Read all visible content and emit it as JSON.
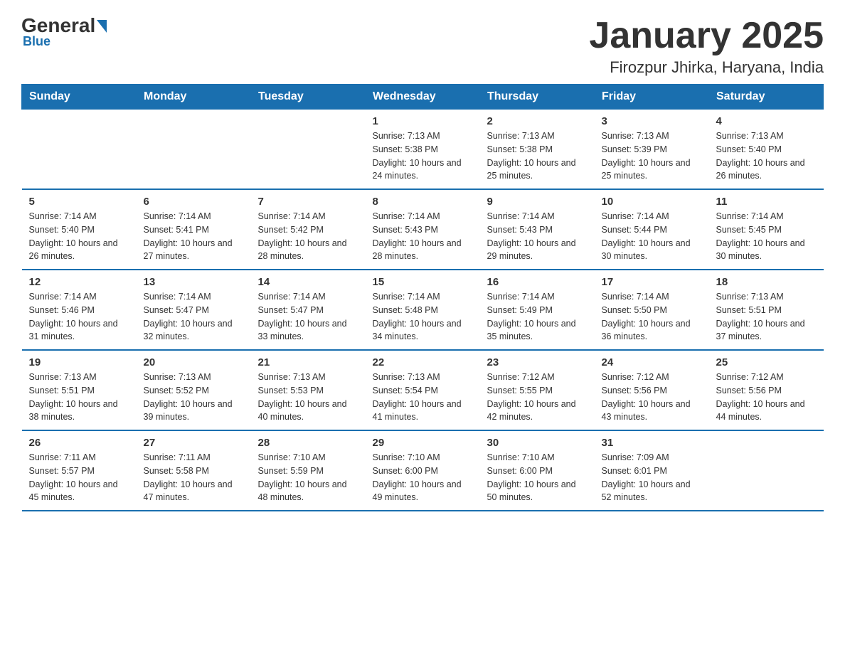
{
  "header": {
    "logo_general": "General",
    "logo_blue": "Blue",
    "title": "January 2025",
    "subtitle": "Firozpur Jhirka, Haryana, India"
  },
  "days_of_week": [
    "Sunday",
    "Monday",
    "Tuesday",
    "Wednesday",
    "Thursday",
    "Friday",
    "Saturday"
  ],
  "weeks": [
    [
      {
        "num": "",
        "sunrise": "",
        "sunset": "",
        "daylight": ""
      },
      {
        "num": "",
        "sunrise": "",
        "sunset": "",
        "daylight": ""
      },
      {
        "num": "",
        "sunrise": "",
        "sunset": "",
        "daylight": ""
      },
      {
        "num": "1",
        "sunrise": "Sunrise: 7:13 AM",
        "sunset": "Sunset: 5:38 PM",
        "daylight": "Daylight: 10 hours and 24 minutes."
      },
      {
        "num": "2",
        "sunrise": "Sunrise: 7:13 AM",
        "sunset": "Sunset: 5:38 PM",
        "daylight": "Daylight: 10 hours and 25 minutes."
      },
      {
        "num": "3",
        "sunrise": "Sunrise: 7:13 AM",
        "sunset": "Sunset: 5:39 PM",
        "daylight": "Daylight: 10 hours and 25 minutes."
      },
      {
        "num": "4",
        "sunrise": "Sunrise: 7:13 AM",
        "sunset": "Sunset: 5:40 PM",
        "daylight": "Daylight: 10 hours and 26 minutes."
      }
    ],
    [
      {
        "num": "5",
        "sunrise": "Sunrise: 7:14 AM",
        "sunset": "Sunset: 5:40 PM",
        "daylight": "Daylight: 10 hours and 26 minutes."
      },
      {
        "num": "6",
        "sunrise": "Sunrise: 7:14 AM",
        "sunset": "Sunset: 5:41 PM",
        "daylight": "Daylight: 10 hours and 27 minutes."
      },
      {
        "num": "7",
        "sunrise": "Sunrise: 7:14 AM",
        "sunset": "Sunset: 5:42 PM",
        "daylight": "Daylight: 10 hours and 28 minutes."
      },
      {
        "num": "8",
        "sunrise": "Sunrise: 7:14 AM",
        "sunset": "Sunset: 5:43 PM",
        "daylight": "Daylight: 10 hours and 28 minutes."
      },
      {
        "num": "9",
        "sunrise": "Sunrise: 7:14 AM",
        "sunset": "Sunset: 5:43 PM",
        "daylight": "Daylight: 10 hours and 29 minutes."
      },
      {
        "num": "10",
        "sunrise": "Sunrise: 7:14 AM",
        "sunset": "Sunset: 5:44 PM",
        "daylight": "Daylight: 10 hours and 30 minutes."
      },
      {
        "num": "11",
        "sunrise": "Sunrise: 7:14 AM",
        "sunset": "Sunset: 5:45 PM",
        "daylight": "Daylight: 10 hours and 30 minutes."
      }
    ],
    [
      {
        "num": "12",
        "sunrise": "Sunrise: 7:14 AM",
        "sunset": "Sunset: 5:46 PM",
        "daylight": "Daylight: 10 hours and 31 minutes."
      },
      {
        "num": "13",
        "sunrise": "Sunrise: 7:14 AM",
        "sunset": "Sunset: 5:47 PM",
        "daylight": "Daylight: 10 hours and 32 minutes."
      },
      {
        "num": "14",
        "sunrise": "Sunrise: 7:14 AM",
        "sunset": "Sunset: 5:47 PM",
        "daylight": "Daylight: 10 hours and 33 minutes."
      },
      {
        "num": "15",
        "sunrise": "Sunrise: 7:14 AM",
        "sunset": "Sunset: 5:48 PM",
        "daylight": "Daylight: 10 hours and 34 minutes."
      },
      {
        "num": "16",
        "sunrise": "Sunrise: 7:14 AM",
        "sunset": "Sunset: 5:49 PM",
        "daylight": "Daylight: 10 hours and 35 minutes."
      },
      {
        "num": "17",
        "sunrise": "Sunrise: 7:14 AM",
        "sunset": "Sunset: 5:50 PM",
        "daylight": "Daylight: 10 hours and 36 minutes."
      },
      {
        "num": "18",
        "sunrise": "Sunrise: 7:13 AM",
        "sunset": "Sunset: 5:51 PM",
        "daylight": "Daylight: 10 hours and 37 minutes."
      }
    ],
    [
      {
        "num": "19",
        "sunrise": "Sunrise: 7:13 AM",
        "sunset": "Sunset: 5:51 PM",
        "daylight": "Daylight: 10 hours and 38 minutes."
      },
      {
        "num": "20",
        "sunrise": "Sunrise: 7:13 AM",
        "sunset": "Sunset: 5:52 PM",
        "daylight": "Daylight: 10 hours and 39 minutes."
      },
      {
        "num": "21",
        "sunrise": "Sunrise: 7:13 AM",
        "sunset": "Sunset: 5:53 PM",
        "daylight": "Daylight: 10 hours and 40 minutes."
      },
      {
        "num": "22",
        "sunrise": "Sunrise: 7:13 AM",
        "sunset": "Sunset: 5:54 PM",
        "daylight": "Daylight: 10 hours and 41 minutes."
      },
      {
        "num": "23",
        "sunrise": "Sunrise: 7:12 AM",
        "sunset": "Sunset: 5:55 PM",
        "daylight": "Daylight: 10 hours and 42 minutes."
      },
      {
        "num": "24",
        "sunrise": "Sunrise: 7:12 AM",
        "sunset": "Sunset: 5:56 PM",
        "daylight": "Daylight: 10 hours and 43 minutes."
      },
      {
        "num": "25",
        "sunrise": "Sunrise: 7:12 AM",
        "sunset": "Sunset: 5:56 PM",
        "daylight": "Daylight: 10 hours and 44 minutes."
      }
    ],
    [
      {
        "num": "26",
        "sunrise": "Sunrise: 7:11 AM",
        "sunset": "Sunset: 5:57 PM",
        "daylight": "Daylight: 10 hours and 45 minutes."
      },
      {
        "num": "27",
        "sunrise": "Sunrise: 7:11 AM",
        "sunset": "Sunset: 5:58 PM",
        "daylight": "Daylight: 10 hours and 47 minutes."
      },
      {
        "num": "28",
        "sunrise": "Sunrise: 7:10 AM",
        "sunset": "Sunset: 5:59 PM",
        "daylight": "Daylight: 10 hours and 48 minutes."
      },
      {
        "num": "29",
        "sunrise": "Sunrise: 7:10 AM",
        "sunset": "Sunset: 6:00 PM",
        "daylight": "Daylight: 10 hours and 49 minutes."
      },
      {
        "num": "30",
        "sunrise": "Sunrise: 7:10 AM",
        "sunset": "Sunset: 6:00 PM",
        "daylight": "Daylight: 10 hours and 50 minutes."
      },
      {
        "num": "31",
        "sunrise": "Sunrise: 7:09 AM",
        "sunset": "Sunset: 6:01 PM",
        "daylight": "Daylight: 10 hours and 52 minutes."
      },
      {
        "num": "",
        "sunrise": "",
        "sunset": "",
        "daylight": ""
      }
    ]
  ]
}
